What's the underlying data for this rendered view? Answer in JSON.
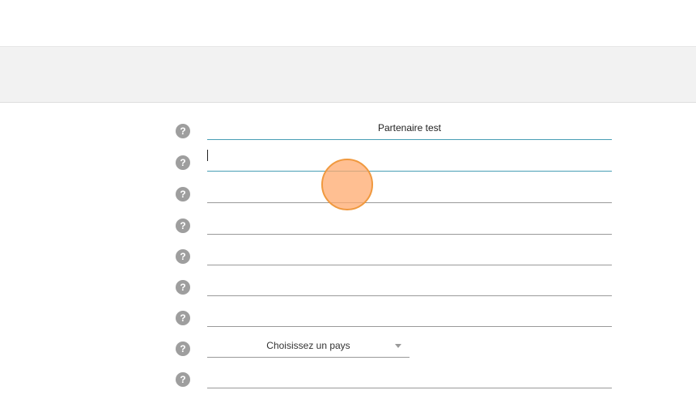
{
  "form": {
    "fields": [
      {
        "value": "Partenaire test",
        "placeholder": ""
      },
      {
        "value": "",
        "placeholder": ""
      },
      {
        "value": "",
        "placeholder": ""
      },
      {
        "value": "",
        "placeholder": ""
      },
      {
        "value": "",
        "placeholder": ""
      },
      {
        "value": "",
        "placeholder": ""
      },
      {
        "value": "",
        "placeholder": ""
      },
      {
        "value": "",
        "placeholder": ""
      }
    ],
    "country_select": {
      "selected": "Choisissez un pays"
    },
    "help_icon_glyph": "?"
  },
  "colors": {
    "focus_underline": "#4a9fb5",
    "underline": "#9a9a9a",
    "help_icon": "#9e9e9e",
    "band": "#f2f2f2",
    "touch_indicator": "#f0993f"
  },
  "icons": [
    "help-icon",
    "chevron-down-icon"
  ]
}
